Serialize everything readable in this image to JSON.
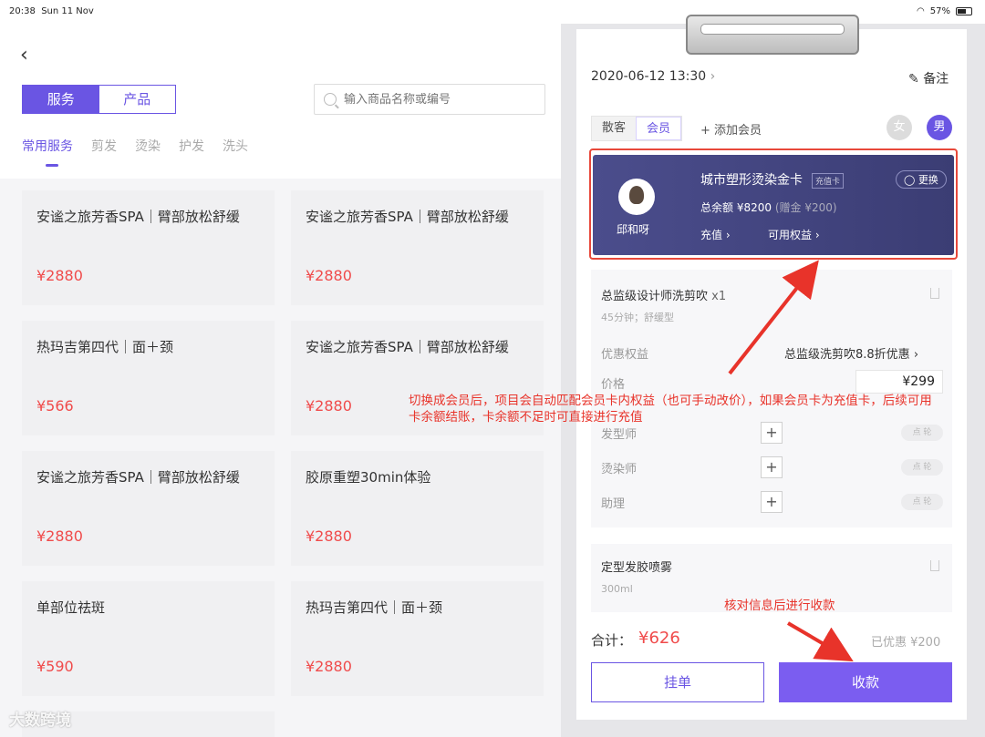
{
  "status": {
    "time": "20:38",
    "date": "Sun 11 Nov",
    "battery": "57%"
  },
  "left": {
    "tabs": [
      "服务",
      "产品"
    ],
    "search_placeholder": "输入商品名称或编号",
    "categories": [
      "常用服务",
      "剪发",
      "烫染",
      "护发",
      "洗头"
    ],
    "products": [
      {
        "name": "安谧之旅芳香SPA｜臂部放松舒缓",
        "price": "¥2880"
      },
      {
        "name": "安谧之旅芳香SPA｜臂部放松舒缓",
        "price": "¥2880"
      },
      {
        "name": "热玛吉第四代｜面＋颈",
        "price": "¥566"
      },
      {
        "name": "安谧之旅芳香SPA｜臂部放松舒缓",
        "price": "¥2880"
      },
      {
        "name": "安谧之旅芳香SPA｜臂部放松舒缓",
        "price": "¥2880"
      },
      {
        "name": "胶原重塑30min体验",
        "price": "¥2880"
      },
      {
        "name": "单部位祛斑",
        "price": "¥590"
      },
      {
        "name": "热玛吉第四代｜面＋颈",
        "price": "¥2880"
      }
    ]
  },
  "order": {
    "datetime": "2020-06-12 13:30",
    "note_label": "备注",
    "customer_types": [
      "散客",
      "会员"
    ],
    "add_member": "+ 添加会员",
    "gender_female": "女",
    "gender_male": "男",
    "member_name": "邱和呀",
    "card_name": "城市塑形烫染金卡",
    "card_tag": "充值卡",
    "card_swap": "更换",
    "balance": "总余额 ¥8200",
    "balance_gift": "(赠金 ¥200)",
    "recharge": "充值",
    "available_rights": "可用权益",
    "service": {
      "title": "总监级设计师洗剪吹",
      "qty": "x1",
      "sub": "45分钟；舒缓型",
      "discount_label": "优惠权益",
      "discount_value": "总监级洗剪吹8.8折优惠",
      "price_label": "价格",
      "price_value": "¥299",
      "staff": [
        "发型师",
        "烫染师",
        "助理"
      ],
      "pill": "点  轮"
    },
    "product2": {
      "title": "定型发胶喷雾",
      "sub": "300ml"
    },
    "total_label": "合计：",
    "total_value": "¥626",
    "discount_total": "已优惠  ¥200",
    "hold_btn": "挂单",
    "pay_btn": "收款"
  },
  "annotations": {
    "main": "切换成会员后，项目会自动匹配会员卡内权益（也可手动改价），如果会员卡为充值卡，后续可用卡余额结账，卡余额不足时可直接进行充值",
    "pay": "核对信息后进行收款"
  },
  "watermark": "大数跨境"
}
